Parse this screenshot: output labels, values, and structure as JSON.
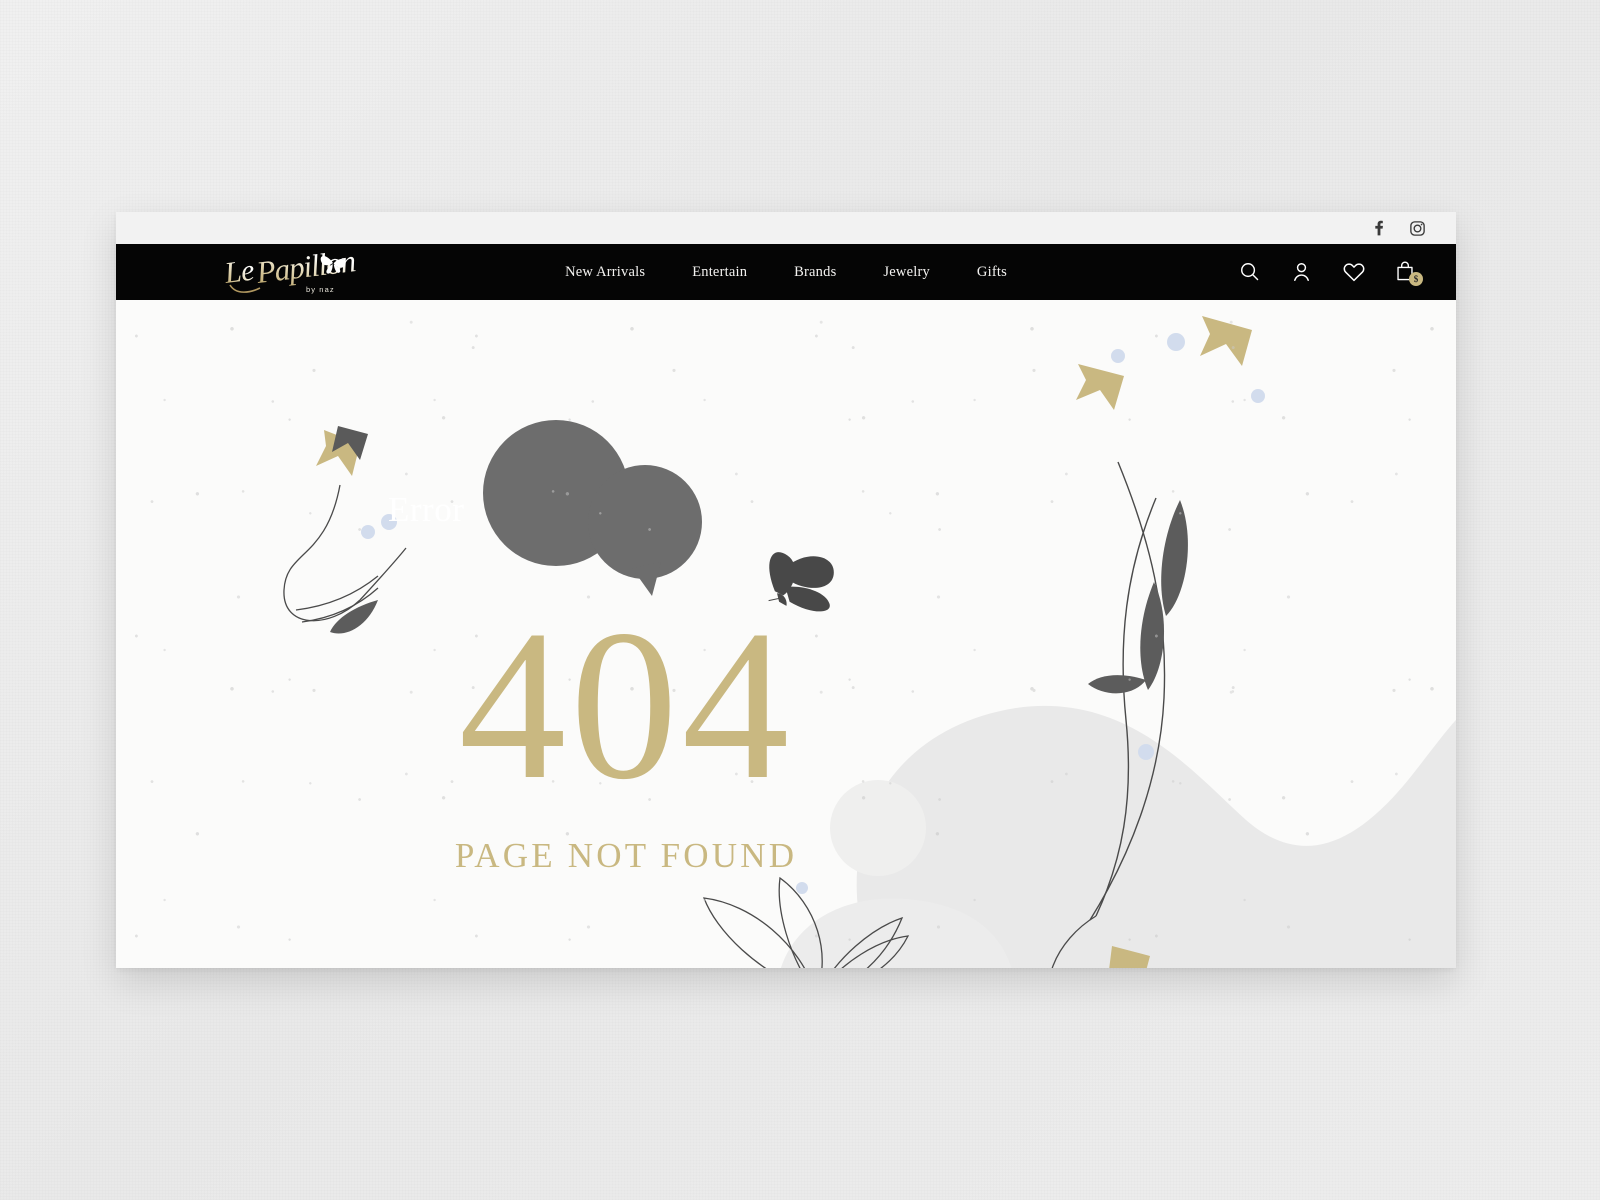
{
  "site": {
    "brand_name": "Le Papillon",
    "brand_tagline": "by naz",
    "accent_gold": "#c9b881",
    "nav_bg": "#050505",
    "page_bg": "#fbfbfa",
    "topbar_bg": "#f2f2f2"
  },
  "topbar": {
    "social": [
      {
        "name": "facebook-icon",
        "label": "Facebook"
      },
      {
        "name": "instagram-icon",
        "label": "Instagram"
      }
    ]
  },
  "nav": {
    "links": [
      {
        "label": "New Arrivals"
      },
      {
        "label": "Entertain"
      },
      {
        "label": "Brands"
      },
      {
        "label": "Jewelry"
      },
      {
        "label": "Gifts"
      }
    ],
    "icons": [
      {
        "name": "search-icon",
        "label": "Search"
      },
      {
        "name": "user-icon",
        "label": "Account"
      },
      {
        "name": "heart-icon",
        "label": "Wishlist"
      },
      {
        "name": "shopping-bag-icon",
        "label": "Cart"
      }
    ],
    "cart_badge": "$"
  },
  "error_page": {
    "bubble_text": "Error",
    "code": "404",
    "message": "PAGE NOT FOUND"
  },
  "decor": {
    "blob_color": "#e9e9e9",
    "circle_color": "#efefee",
    "bubble_color": "#6d6d6d",
    "leaf_color": "#5c5c5c",
    "stem_color": "#4a4a4a",
    "dot_color": "#d2dced",
    "flower_gold": "#c9b881",
    "flower_gray": "#5a5a5a",
    "butterfly_color": "#484848"
  }
}
